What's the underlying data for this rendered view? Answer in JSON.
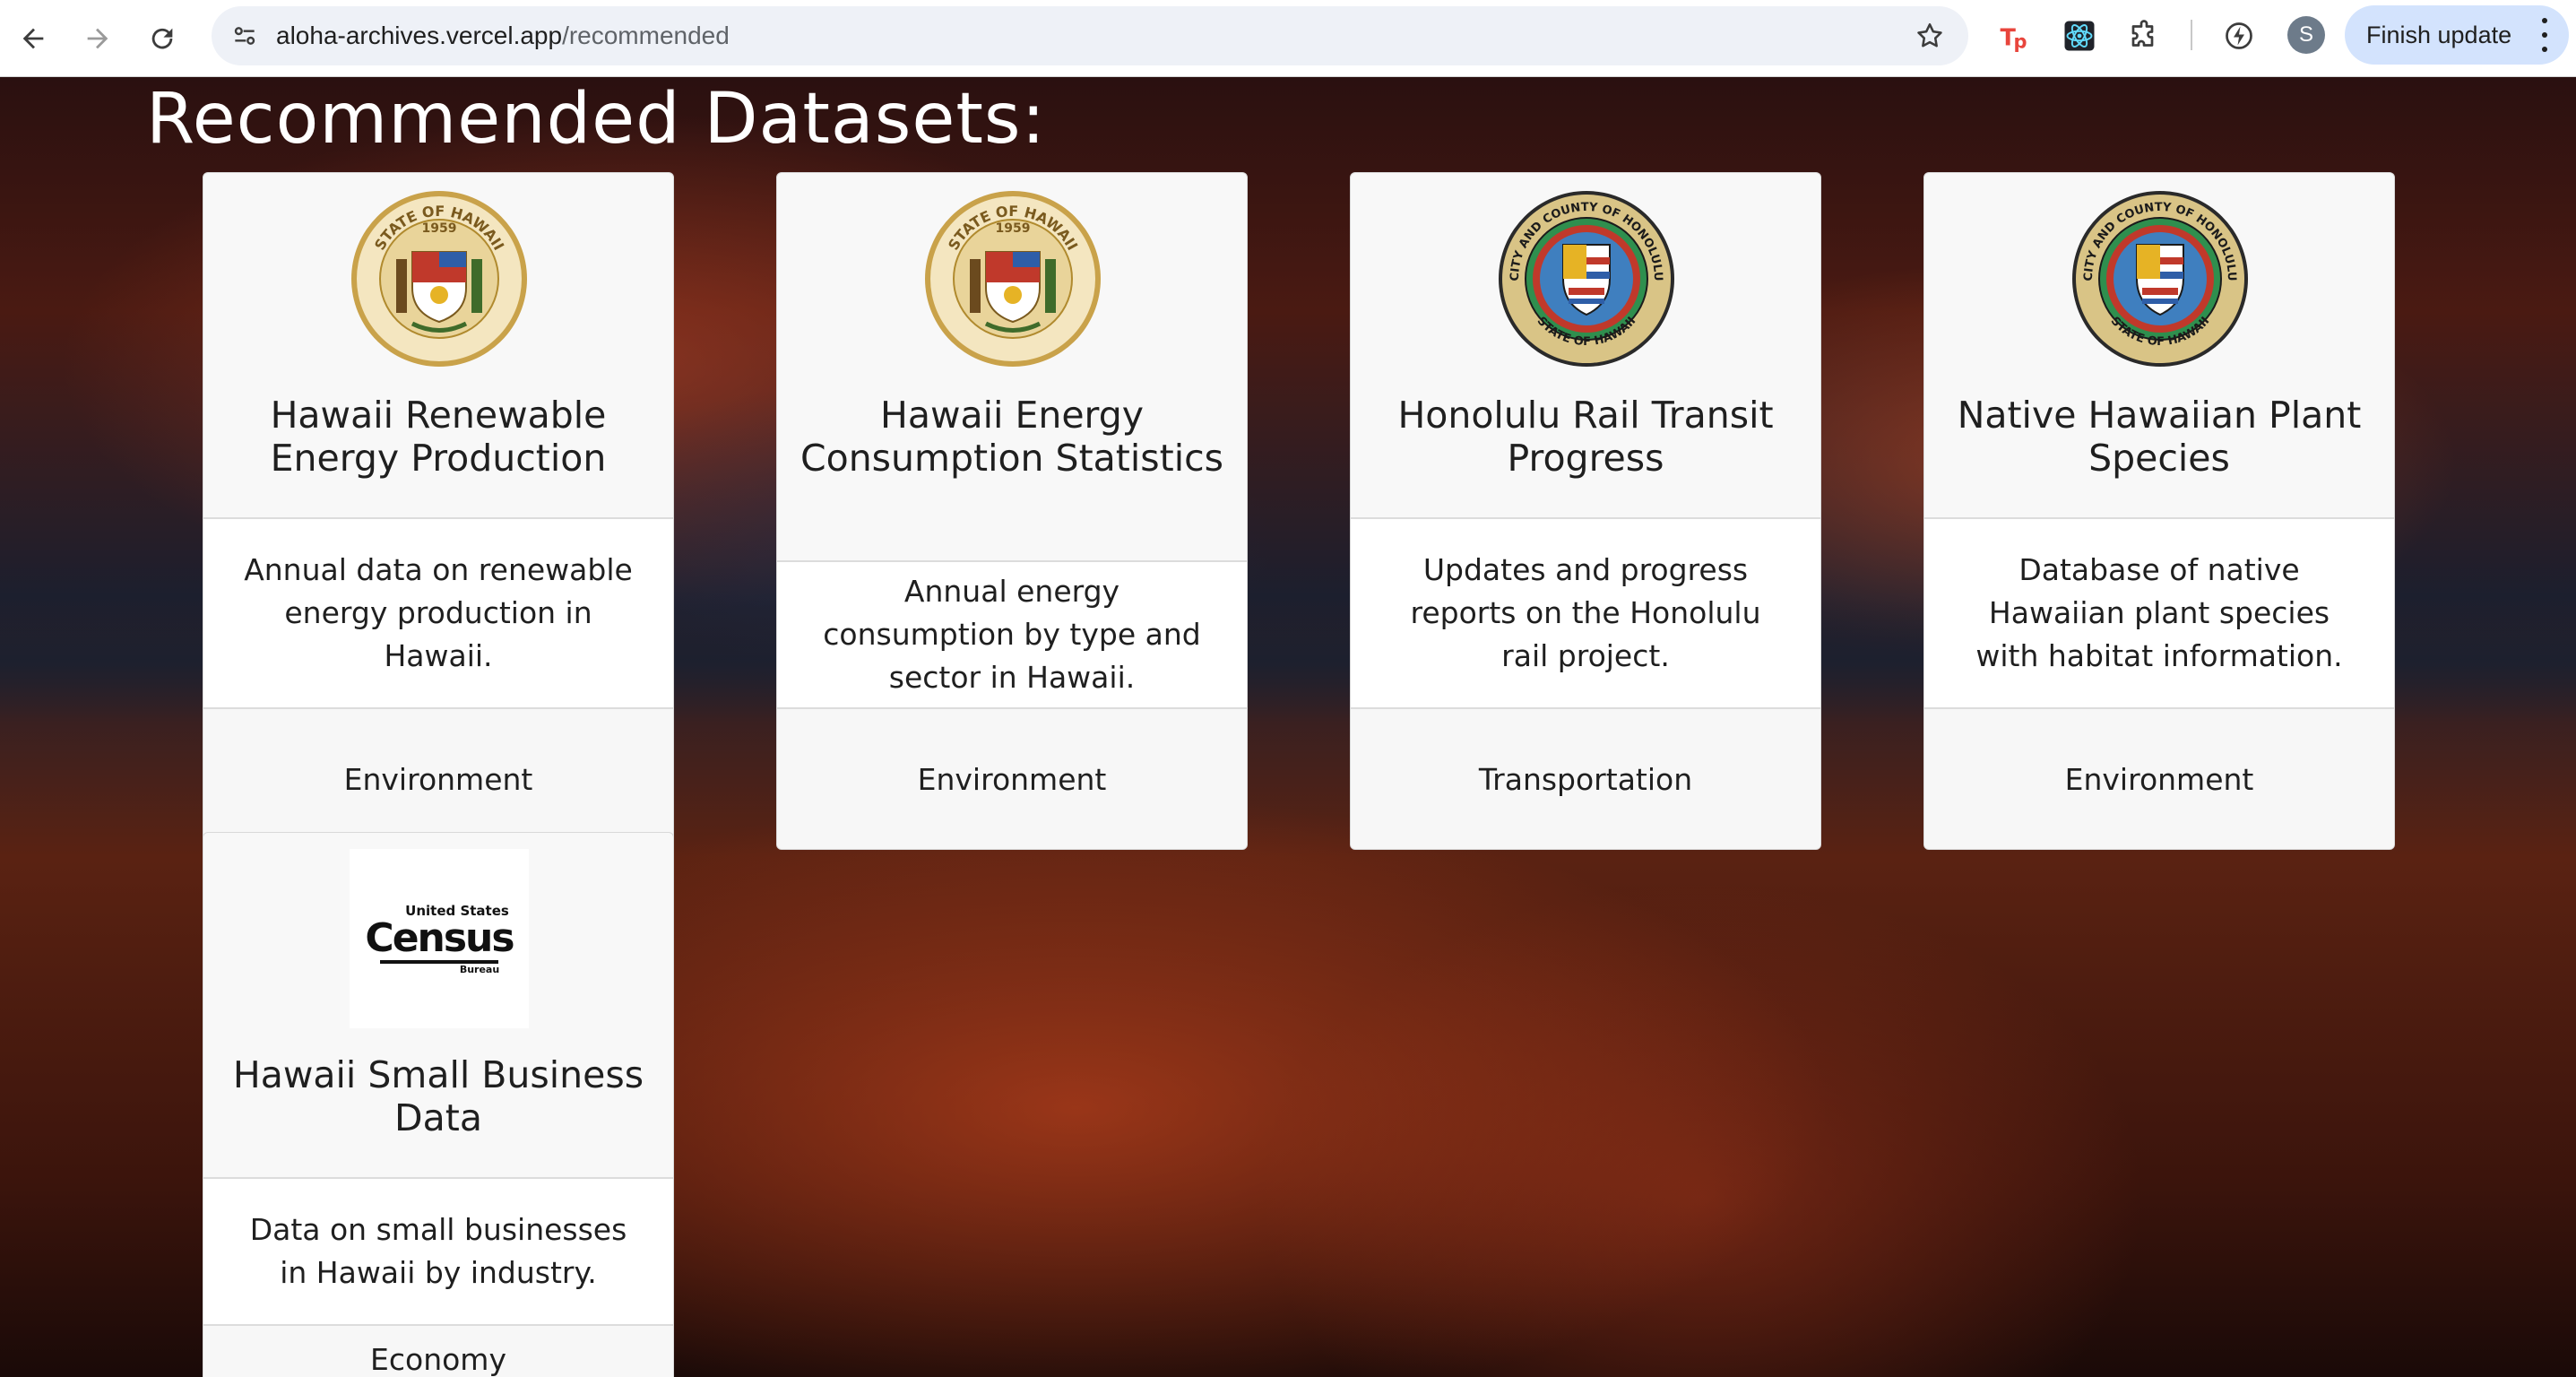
{
  "browser": {
    "url_host": "aloha-archives.vercel.app",
    "url_path": "/recommended",
    "finish_update_label": "Finish update",
    "profile_initial": "S",
    "extensions": [
      "tp-extension-icon",
      "react-devtools-icon",
      "extensions-puzzle-icon",
      "performance-icon"
    ]
  },
  "page": {
    "title": "Recommended Datasets:"
  },
  "cards": [
    {
      "logo": "state-of-hawaii-seal",
      "seal_top": "STATE OF HAWAII",
      "seal_year": "1959",
      "title": "Hawaii Renewable Energy Production",
      "description": "Annual data on renewable energy production in Hawaii.",
      "category": "Environment"
    },
    {
      "logo": "state-of-hawaii-seal",
      "seal_top": "STATE OF HAWAII",
      "seal_year": "1959",
      "title": "Hawaii Energy Consumption Statistics",
      "description": "Annual energy consumption by type and sector in Hawaii.",
      "category": "Environment"
    },
    {
      "logo": "city-county-honolulu-seal",
      "seal_top": "CITY AND COUNTY OF HONOLULU",
      "seal_bottom": "STATE OF HAWAII",
      "title": "Honolulu Rail Transit Progress",
      "description": "Updates and progress reports on the Honolulu rail project.",
      "category": "Transportation"
    },
    {
      "logo": "city-county-honolulu-seal",
      "seal_top": "CITY AND COUNTY OF HONOLULU",
      "seal_bottom": "STATE OF HAWAII",
      "title": "Native Hawaiian Plant Species",
      "description": "Database of native Hawaiian plant species with habitat information.",
      "category": "Environment"
    },
    {
      "logo": "us-census-bureau-logo",
      "census_top": "United States",
      "census_main": "Census",
      "census_bottom": "Bureau",
      "title": "Hawaii Small Business Data",
      "description": "Data on small businesses in Hawaii by industry.",
      "category": "Economy"
    }
  ],
  "colors": {
    "accent_button": "#d3e3fd",
    "card_bg": "#f8f8f8",
    "title_text": "#ffffff"
  }
}
